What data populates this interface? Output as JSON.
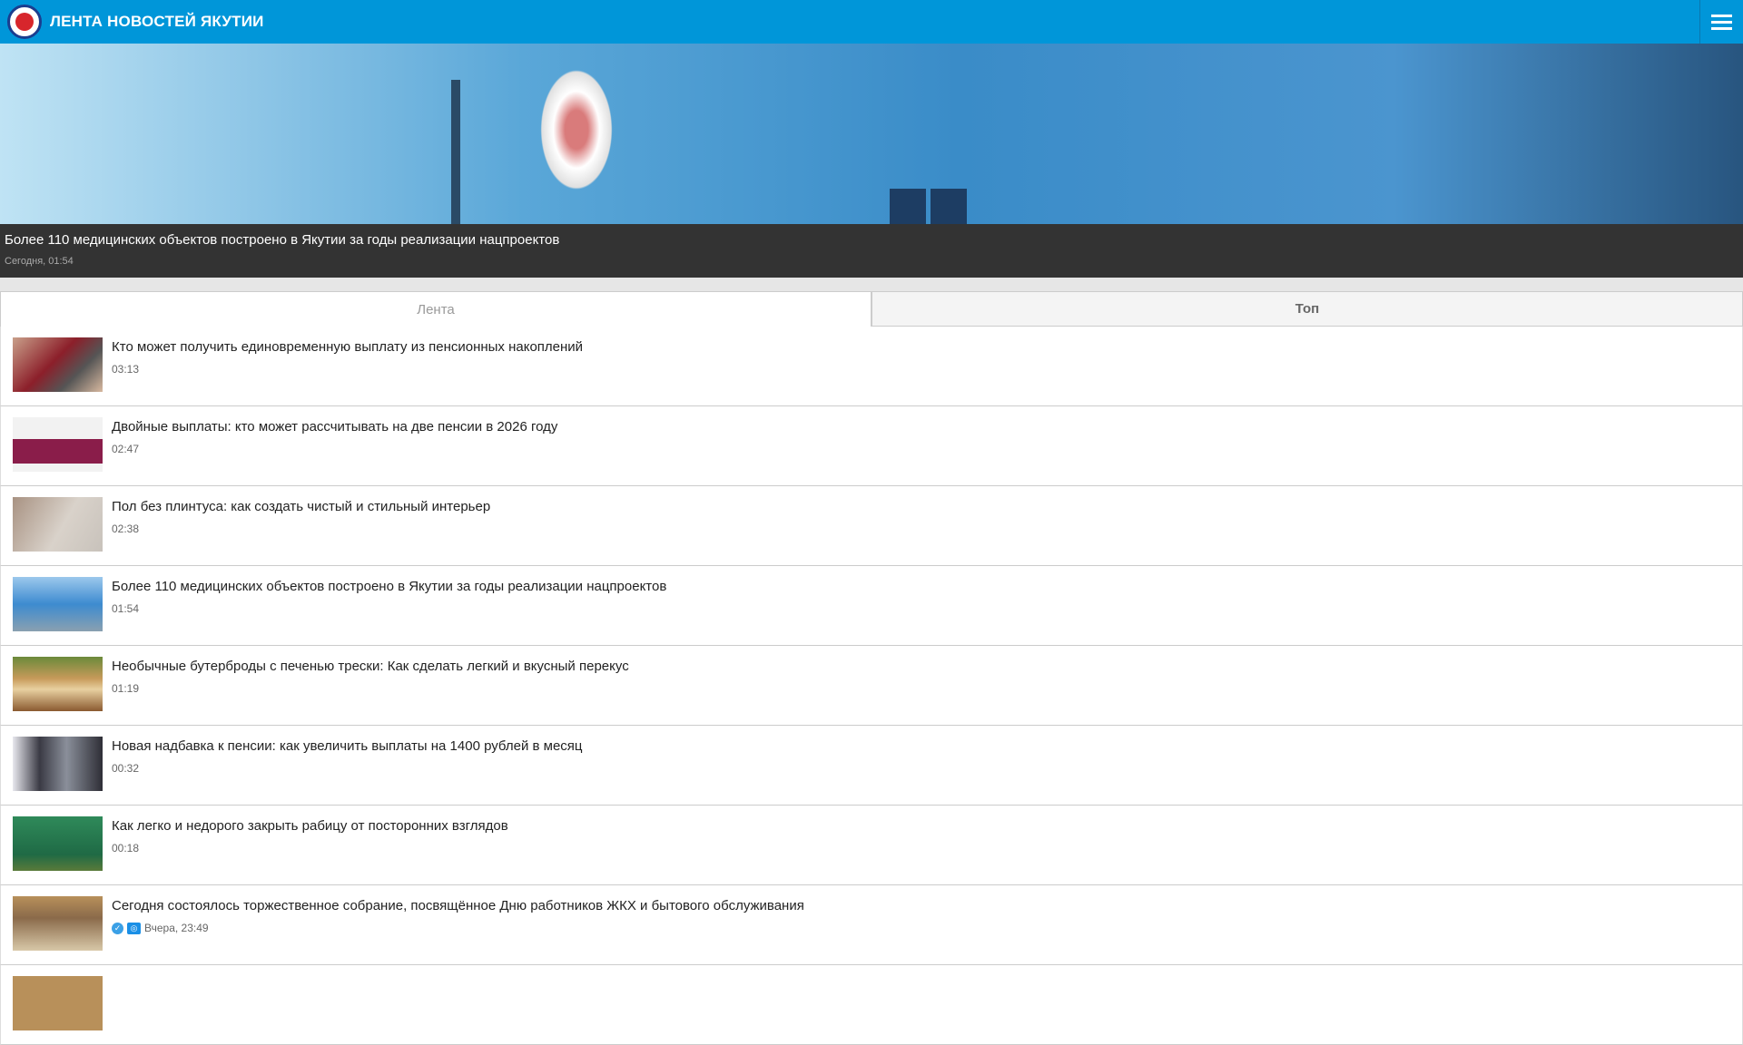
{
  "header": {
    "title": "ЛЕНТА НОВОСТЕЙ ЯКУТИИ",
    "menu_icon": "hamburger-icon",
    "color": "#0096d9"
  },
  "featured": {
    "title": "Более 110 медицинских объектов построено в Якутии за годы реализации нацпроектов",
    "time": "Сегодня, 01:54"
  },
  "tabs": [
    {
      "label": "Лента",
      "active": true
    },
    {
      "label": "Топ",
      "active": false
    }
  ],
  "news": [
    {
      "title": "Кто может получить единовременную выплату из пенсионных накоплений",
      "time": "03:13"
    },
    {
      "title": "Двойные выплаты: кто может рассчитывать на две пенсии в 2026 году",
      "time": "02:47"
    },
    {
      "title": "Пол без плинтуса: как создать чистый и стильный интерьер",
      "time": "02:38"
    },
    {
      "title": "Более 110 медицинских объектов построено в Якутии за годы реализации нацпроектов",
      "time": "01:54"
    },
    {
      "title": "Необычные бутерброды с печенью трески: Как сделать легкий и вкусный перекус",
      "time": "01:19"
    },
    {
      "title": "Новая надбавка к пенсии: как увеличить выплаты на 1400 рублей в месяц",
      "time": "00:32"
    },
    {
      "title": "Как легко и недорого закрыть рабицу от посторонних взглядов",
      "time": "00:18"
    },
    {
      "title": "Сегодня состоялось торжественное собрание, посвящённое Дню работников ЖКХ и бытового обслуживания",
      "time": "Вчера, 23:49"
    }
  ]
}
